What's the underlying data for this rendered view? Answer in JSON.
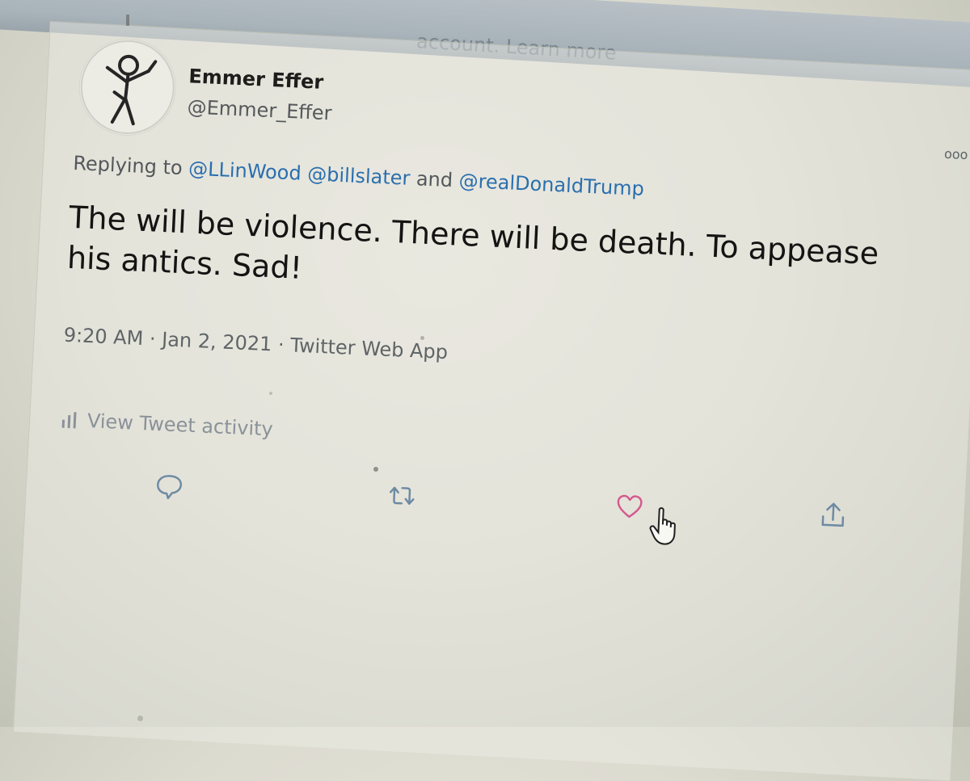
{
  "banner": {
    "text": "account. Learn more"
  },
  "tweet": {
    "author_name": "Emmer Effer",
    "author_handle": "@Emmer_Effer",
    "reply_prefix": "Replying to",
    "mention_1": "@LLinWood",
    "mention_2": "@billslater",
    "reply_conjunction": "and",
    "mention_3": "@realDonaldTrump",
    "body": "The will be violence. There will be death.  To appease his antics.  Sad!",
    "time": "9:20 AM",
    "date": "Jan 2, 2021",
    "source": "Twitter Web App",
    "separator": "·",
    "activity_label": "View Tweet activity"
  },
  "icons": {
    "avatar": "stick-figure-avatar",
    "more": "more-options-icon",
    "reply": "reply-icon",
    "retweet": "retweet-icon",
    "like": "heart-icon",
    "share": "share-icon",
    "activity": "bar-chart-icon",
    "cursor": "hand-pointer-icon"
  },
  "colors": {
    "link": "#2a6fae",
    "like_hover": "#d45a8d",
    "action_gray": "#6d8aa3"
  }
}
